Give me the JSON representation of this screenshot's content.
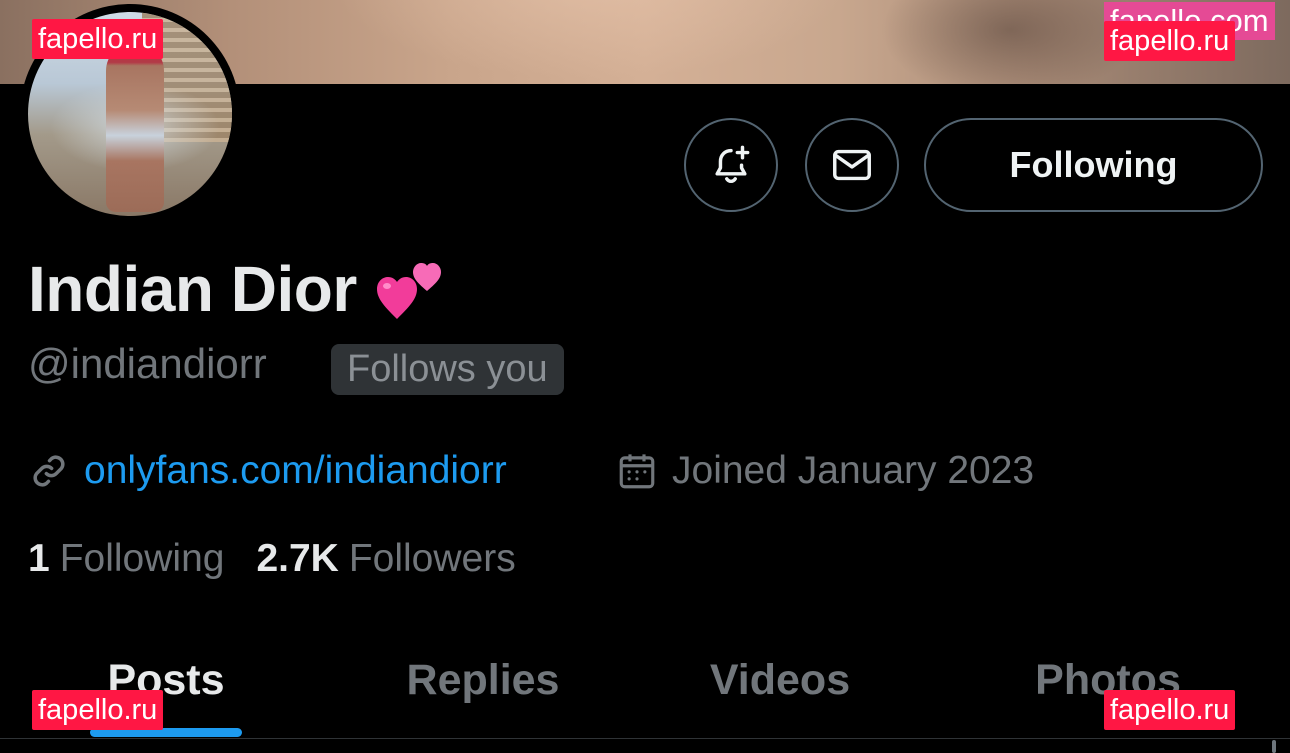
{
  "profile": {
    "display_name": "Indian Dior",
    "name_emoji": "💕",
    "handle": "@indiandiorr",
    "follows_you_badge": "Follows you",
    "website": "onlyfans.com/indiandiorr",
    "joined": "Joined January 2023",
    "following_count": "1",
    "following_label": "Following",
    "followers_count": "2.7K",
    "followers_label": "Followers"
  },
  "actions": {
    "notify_icon": "bell-plus-icon",
    "message_icon": "envelope-icon",
    "follow_button_label": "Following"
  },
  "tabs": [
    {
      "label": "Posts",
      "active": true
    },
    {
      "label": "Replies",
      "active": false
    },
    {
      "label": "Videos",
      "active": false
    },
    {
      "label": "Photos",
      "active": false
    }
  ],
  "watermarks": {
    "top_left": "fapello.ru",
    "top_right_upper": "fapello.com",
    "top_right": "fapello.ru",
    "bottom_left": "fapello.ru",
    "bottom_right": "fapello.ru"
  },
  "colors": {
    "background": "#000000",
    "accent_link": "#1d9bf0",
    "muted_text": "#71767b",
    "border": "#536471",
    "watermark": "#ff1744"
  }
}
